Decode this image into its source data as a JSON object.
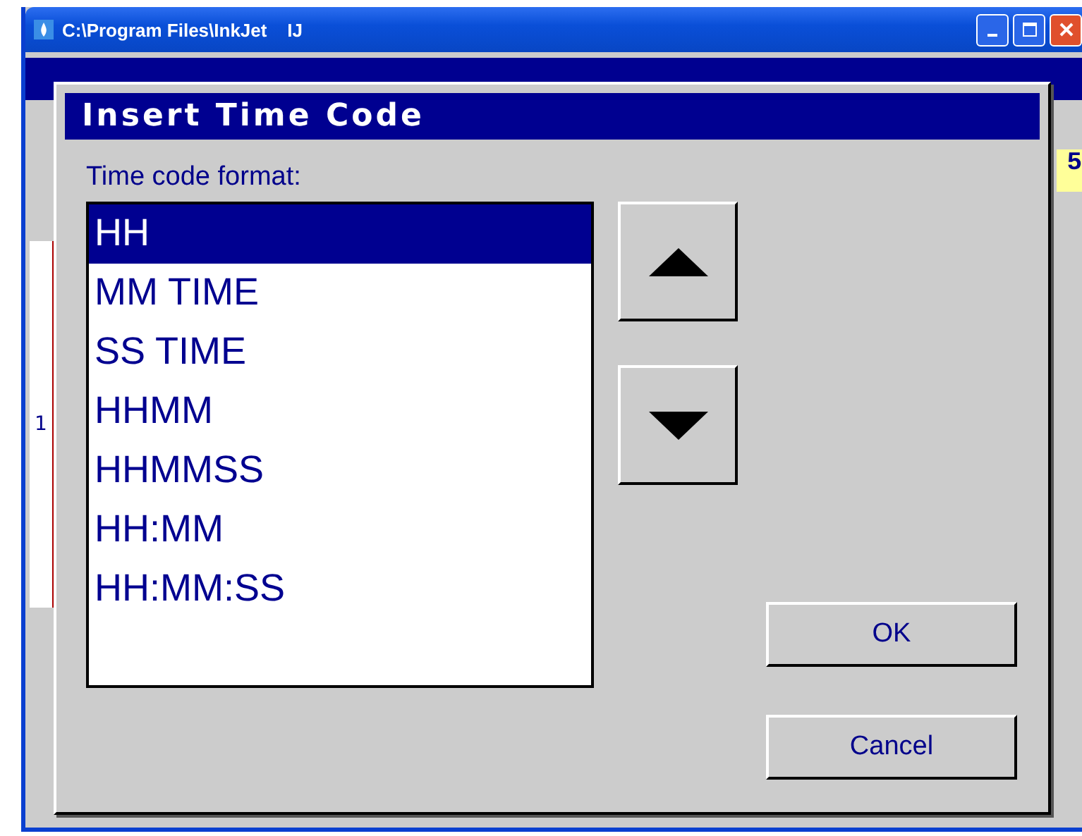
{
  "window": {
    "title": "C:\\Program Files\\InkJet    IJ"
  },
  "background": {
    "row_number": "1",
    "counter": "5"
  },
  "dialog": {
    "title": "Insert Time Code",
    "list_label": "Time code format:",
    "formats": [
      {
        "label": "HH",
        "selected": true
      },
      {
        "label": "MM TIME",
        "selected": false
      },
      {
        "label": "SS TIME",
        "selected": false
      },
      {
        "label": "HHMM",
        "selected": false
      },
      {
        "label": "HHMMSS",
        "selected": false
      },
      {
        "label": "HH:MM",
        "selected": false
      },
      {
        "label": "HH:MM:SS",
        "selected": false
      }
    ],
    "ok": "OK",
    "cancel": "Cancel"
  }
}
